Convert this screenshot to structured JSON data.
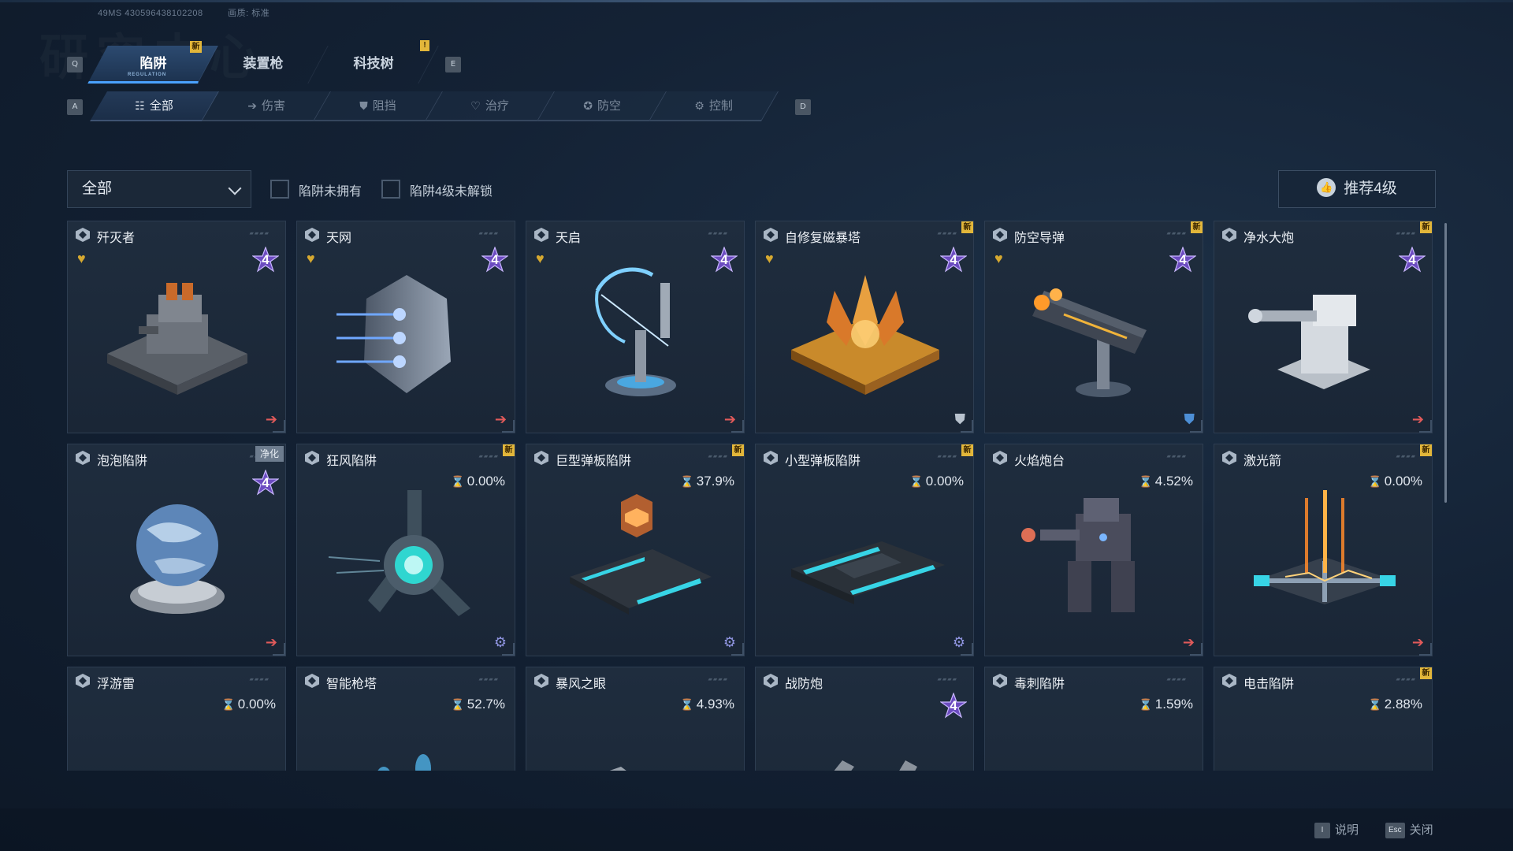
{
  "session": {
    "id": "49MS 430596438102208",
    "quality": "画质: 标准"
  },
  "watermark": "研究中心",
  "keys": {
    "prev_tab": "Q",
    "next_tab": "E",
    "prev_cat": "A",
    "next_cat": "D"
  },
  "main_tabs": [
    {
      "label": "陷阱",
      "sub": "REGULATION",
      "active": true,
      "badge": "新"
    },
    {
      "label": "装置枪",
      "sub": "",
      "active": false
    },
    {
      "label": "科技树",
      "sub": "",
      "active": false,
      "badge": "!"
    }
  ],
  "categories": [
    {
      "label": "全部",
      "icon": "list-icon",
      "glyph": "☷",
      "active": true
    },
    {
      "label": "伤害",
      "icon": "arrow-right-icon",
      "glyph": "➔",
      "active": false
    },
    {
      "label": "阻挡",
      "icon": "shield-icon",
      "glyph": "⛊",
      "active": false
    },
    {
      "label": "治疗",
      "icon": "heart-plus-icon",
      "glyph": "♡",
      "active": false
    },
    {
      "label": "防空",
      "icon": "aa-shield-icon",
      "glyph": "✪",
      "active": false
    },
    {
      "label": "控制",
      "icon": "gear-icon",
      "glyph": "⚙",
      "active": false
    }
  ],
  "filter": {
    "dropdown_value": "全部",
    "check_not_owned": "陷阱未拥有",
    "check_lv4_locked": "陷阱4级未解锁",
    "recommend_label": "推荐4级"
  },
  "colors": {
    "accent": "#4aa2ff",
    "new_badge": "#e2b63a",
    "favorite": "#d6a930",
    "arrow": "#e15a5a",
    "star_purple": "#9a6fe0"
  },
  "traps": [
    {
      "name": "歼灭者",
      "favorite": true,
      "level": "4",
      "progress": null,
      "new": false,
      "tag": null,
      "footer": "arrow",
      "art": "tank"
    },
    {
      "name": "天网",
      "favorite": true,
      "level": "4",
      "progress": null,
      "new": false,
      "tag": null,
      "footer": "arrow",
      "art": "shield"
    },
    {
      "name": "天启",
      "favorite": true,
      "level": "4",
      "progress": null,
      "new": false,
      "tag": null,
      "footer": "arrow",
      "art": "bow"
    },
    {
      "name": "自修复磁暴塔",
      "favorite": true,
      "level": "4",
      "progress": null,
      "new": true,
      "tag": null,
      "footer": "shield-w",
      "art": "crystal"
    },
    {
      "name": "防空导弹",
      "favorite": true,
      "level": "4",
      "progress": null,
      "new": true,
      "tag": null,
      "footer": "shield-b",
      "art": "missile"
    },
    {
      "name": "净水大炮",
      "favorite": false,
      "level": "4",
      "progress": null,
      "new": true,
      "tag": null,
      "footer": "arrow",
      "art": "cannon"
    },
    {
      "name": "泡泡陷阱",
      "favorite": false,
      "level": "4",
      "progress": null,
      "new": false,
      "tag": "净化",
      "footer": "arrow",
      "art": "globe"
    },
    {
      "name": "狂风陷阱",
      "favorite": false,
      "level": null,
      "progress": "0.00%",
      "new": true,
      "tag": null,
      "footer": "gear",
      "art": "fan"
    },
    {
      "name": "巨型弹板陷阱",
      "favorite": false,
      "level": null,
      "progress": "37.9%",
      "new": true,
      "tag": null,
      "footer": "gear",
      "art": "padbig"
    },
    {
      "name": "小型弹板陷阱",
      "favorite": false,
      "level": null,
      "progress": "0.00%",
      "new": true,
      "tag": null,
      "footer": "gear",
      "art": "pad"
    },
    {
      "name": "火焰炮台",
      "favorite": false,
      "level": null,
      "progress": "4.52%",
      "new": false,
      "tag": null,
      "footer": "arrow",
      "art": "mech"
    },
    {
      "name": "激光箭",
      "favorite": false,
      "level": null,
      "progress": "0.00%",
      "new": true,
      "tag": null,
      "footer": "arrow",
      "art": "laser"
    },
    {
      "name": "浮游雷",
      "favorite": false,
      "level": null,
      "progress": "0.00%",
      "new": false,
      "tag": null,
      "footer": null,
      "art": "drone"
    },
    {
      "name": "智能枪塔",
      "favorite": false,
      "level": null,
      "progress": "52.7%",
      "new": false,
      "tag": null,
      "footer": null,
      "art": "turret"
    },
    {
      "name": "暴风之眼",
      "favorite": false,
      "level": null,
      "progress": "4.93%",
      "new": false,
      "tag": null,
      "footer": null,
      "art": "storm"
    },
    {
      "name": "战防炮",
      "favorite": false,
      "level": "4",
      "progress": null,
      "new": false,
      "tag": null,
      "footer": null,
      "art": "gun"
    },
    {
      "name": "毒刺陷阱",
      "favorite": false,
      "level": null,
      "progress": "1.59%",
      "new": false,
      "tag": null,
      "footer": null,
      "art": "spike"
    },
    {
      "name": "电击陷阱",
      "favorite": false,
      "level": null,
      "progress": "2.88%",
      "new": true,
      "tag": null,
      "footer": null,
      "art": "shock"
    }
  ],
  "footer_hints": [
    {
      "key": "I",
      "label": "说明"
    },
    {
      "key": "Esc",
      "label": "关闭"
    }
  ]
}
